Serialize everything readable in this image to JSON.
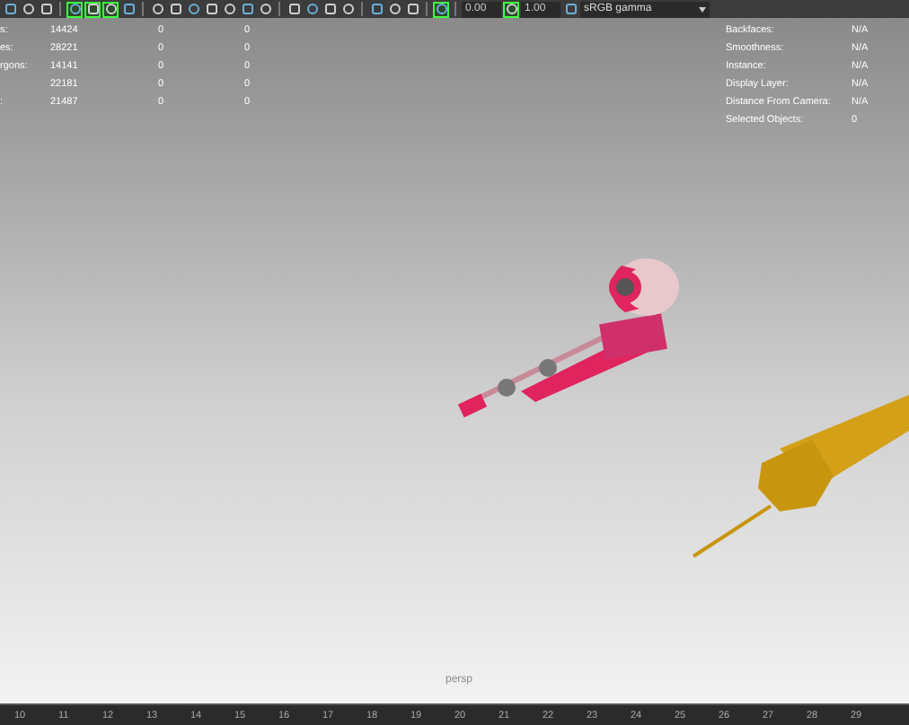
{
  "toolbar": {
    "buttons": [
      {
        "on": false
      },
      {
        "on": false
      },
      {
        "on": false
      },
      {
        "on": true
      },
      {
        "on": true
      },
      {
        "on": true
      },
      {
        "on": false
      },
      {
        "on": false
      },
      {
        "on": false
      },
      {
        "on": false
      },
      {
        "on": false
      },
      {
        "on": false
      },
      {
        "on": false
      },
      {
        "on": false
      },
      {
        "on": false
      },
      {
        "on": false
      },
      {
        "on": false
      },
      {
        "on": false
      },
      {
        "on": false
      },
      {
        "on": false
      },
      {
        "on": false
      },
      {
        "on": true
      }
    ],
    "exposure": "0.00",
    "gamma": "1.00",
    "color_space": "sRGB gamma"
  },
  "hud_left": [
    {
      "label": "s:",
      "values": [
        "14424",
        "0",
        "0"
      ]
    },
    {
      "label": "es:",
      "values": [
        "28221",
        "0",
        "0"
      ]
    },
    {
      "label": "rgons:",
      "values": [
        "14141",
        "0",
        "0"
      ]
    },
    {
      "values": [
        "22181",
        "0",
        "0"
      ]
    },
    {
      "label": ":",
      "values": [
        "21487",
        "0",
        "0"
      ]
    }
  ],
  "hud_right": [
    {
      "label": "Backfaces:",
      "value": "N/A"
    },
    {
      "label": "Smoothness:",
      "value": "N/A"
    },
    {
      "label": "Instance:",
      "value": "N/A"
    },
    {
      "label": "Display Layer:",
      "value": "N/A"
    },
    {
      "label": "Distance From Camera:",
      "value": "N/A"
    },
    {
      "label": "Selected Objects:",
      "value": "0"
    }
  ],
  "camera": "persp",
  "timeline": [
    "10",
    "11",
    "12",
    "13",
    "14",
    "15",
    "16",
    "17",
    "18",
    "19",
    "20",
    "21",
    "22",
    "23",
    "24",
    "25",
    "26",
    "27",
    "28",
    "29"
  ]
}
